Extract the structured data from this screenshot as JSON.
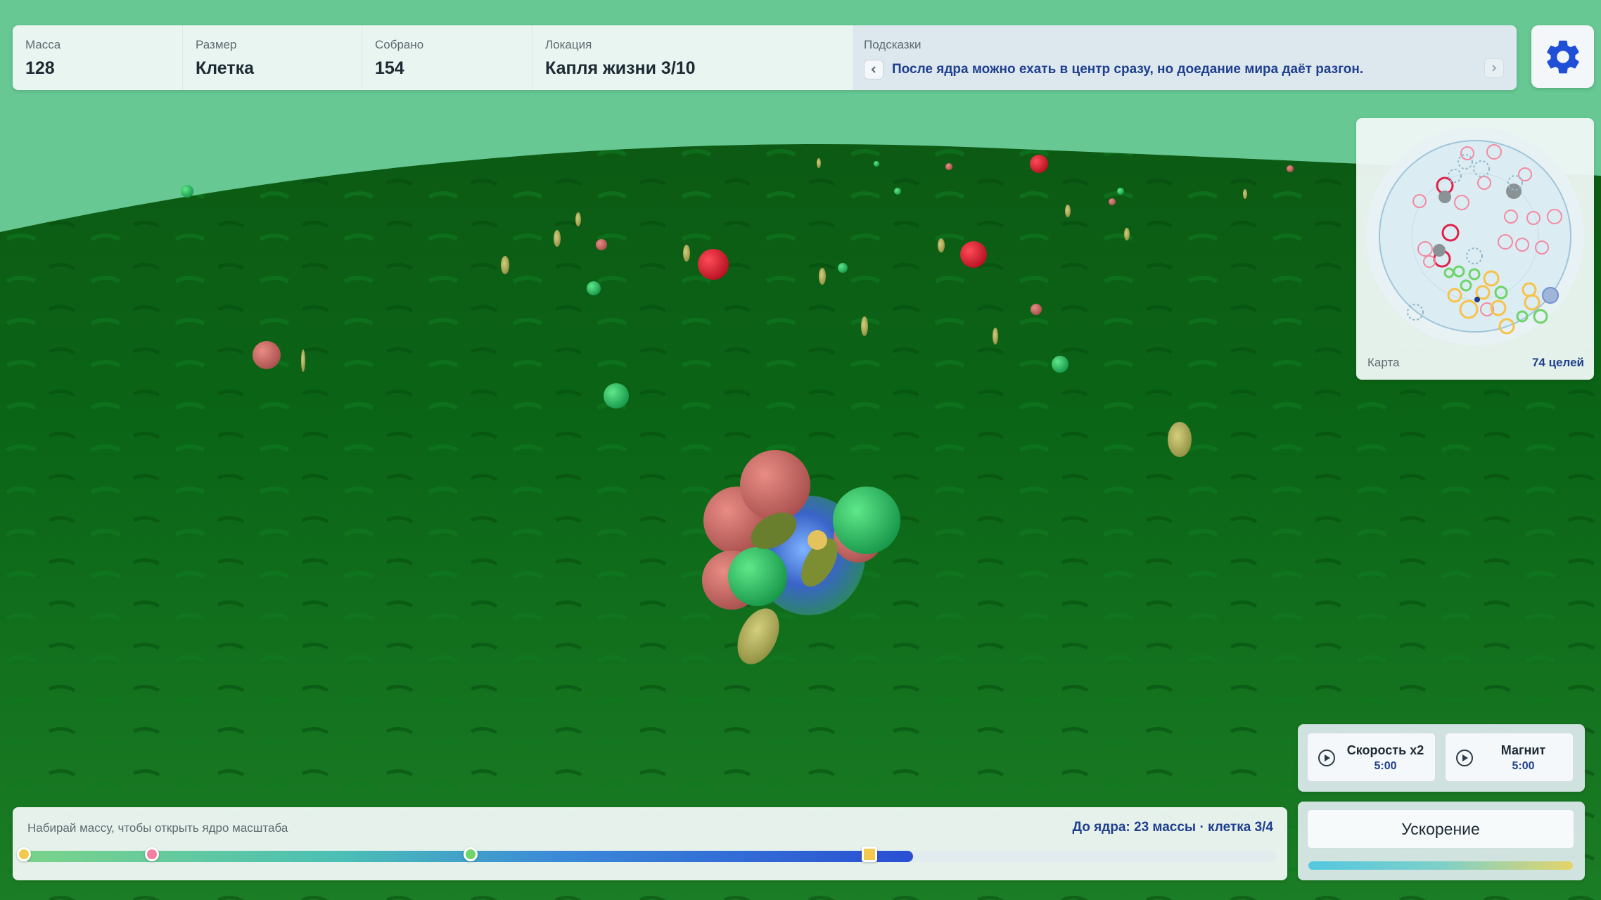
{
  "colors": {
    "sky": "#67c893",
    "grass_dark": "#0a6317",
    "grass_light": "#1b8a2c",
    "accent_blue": "#1f3f8e",
    "food_red": "#dc2434",
    "food_pink": "#c96a66",
    "food_green": "#31c462",
    "food_yellow": "#b9b467"
  },
  "stats": {
    "mass": {
      "label": "Масса",
      "value": "128"
    },
    "size": {
      "label": "Размер",
      "value": "Клетка"
    },
    "collected": {
      "label": "Собрано",
      "value": "154"
    },
    "location": {
      "label": "Локация",
      "value": "Капля жизни 3/10"
    }
  },
  "hints": {
    "label": "Подсказки",
    "prev_icon": "chevron-left-icon",
    "next_icon": "chevron-right-icon",
    "text": "После ядра можно ехать в центр сразу, но доедание мира даёт разгон."
  },
  "settings": {
    "icon": "gear-icon"
  },
  "minimap": {
    "label": "Карта",
    "targets": "74 целей"
  },
  "boosts": {
    "speed": {
      "icon": "play-circle-icon",
      "name": "Скорость x2",
      "timer": "5:00"
    },
    "magnet": {
      "icon": "play-circle-icon",
      "name": "Магнит",
      "timer": "5:00"
    }
  },
  "acceleration": {
    "label": "Ускорение",
    "charge": 1.0
  },
  "progress": {
    "hint": "Набирай массу, чтобы открыть ядро масштаба",
    "goal": "До ядра: 23 массы · клетка 3/4",
    "fill_fraction": 0.71,
    "milestones": [
      {
        "position": 0.0,
        "color": "#f2c94c",
        "shape": "circle"
      },
      {
        "position": 0.102,
        "color": "#f47fa0",
        "shape": "circle"
      },
      {
        "position": 0.357,
        "color": "#6fd46a",
        "shape": "circle"
      },
      {
        "position": 0.675,
        "color": "#f2c94c",
        "shape": "square"
      }
    ]
  }
}
